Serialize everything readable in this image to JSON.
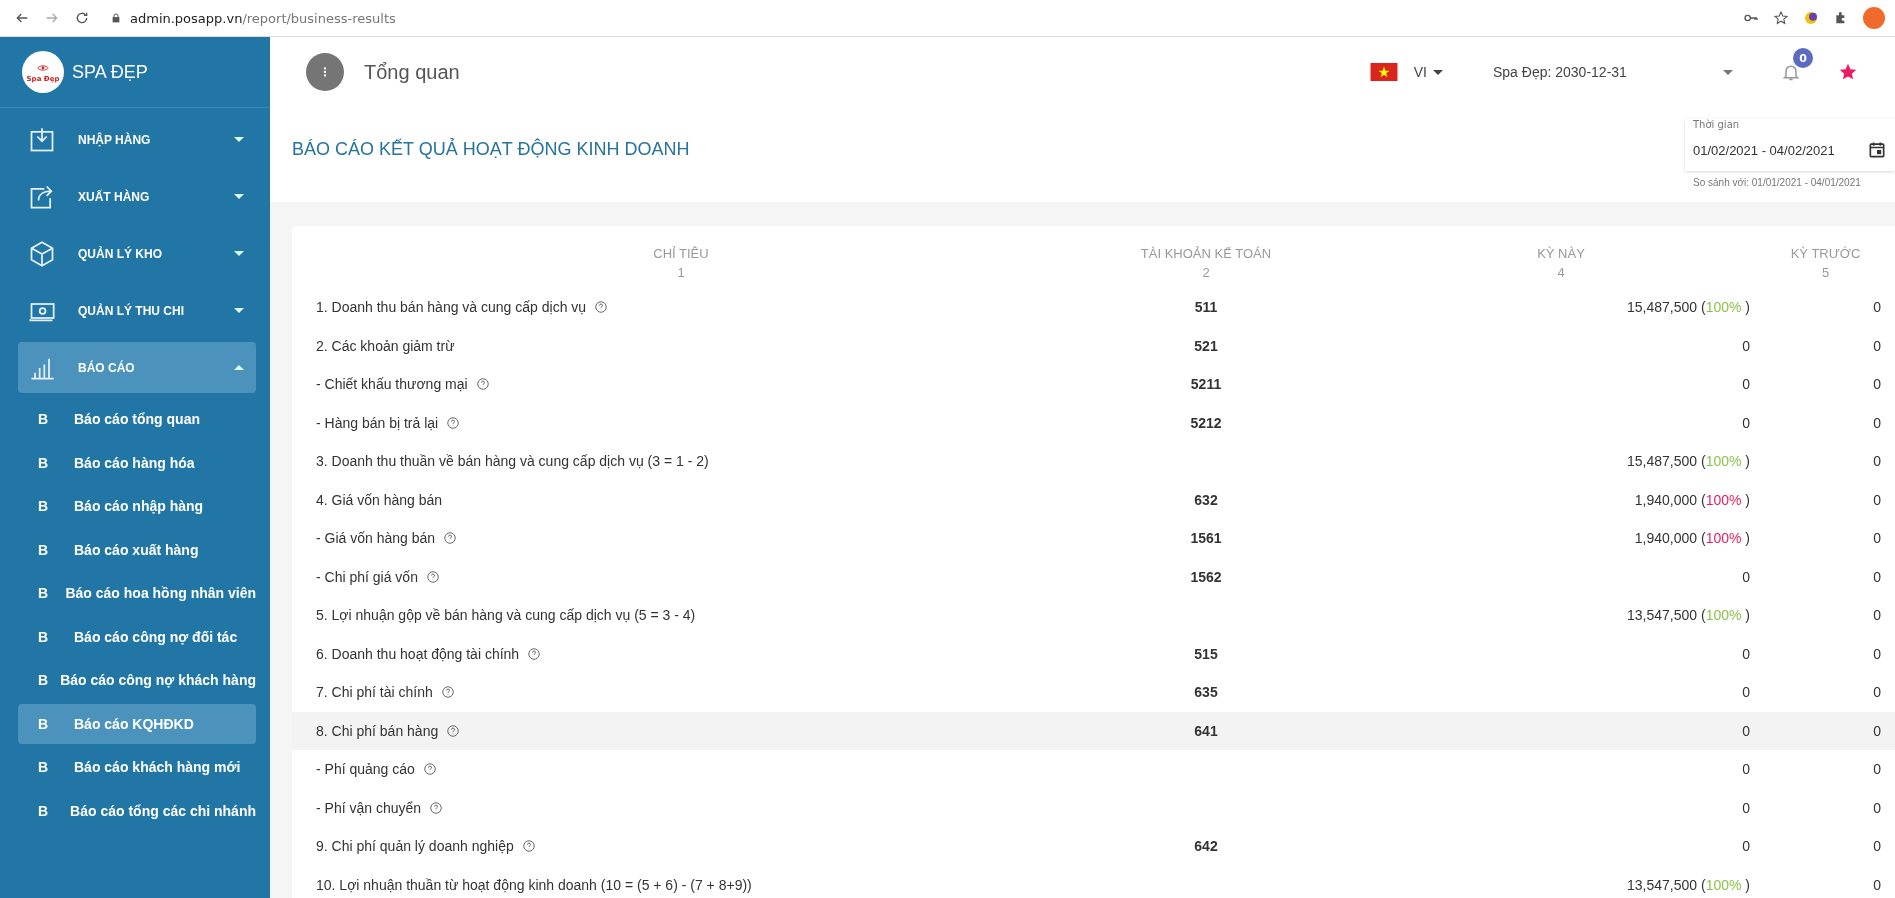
{
  "browser": {
    "url_host": "admin.posapp.vn",
    "url_path": "/report/business-results"
  },
  "sidebar": {
    "brand": "SPA ĐẸP",
    "logo_text": "Spa Đẹp",
    "items": [
      {
        "kind": "import",
        "label": "NHẬP HÀNG",
        "expanded": false,
        "selected": false
      },
      {
        "kind": "export",
        "label": "XUẤT HÀNG",
        "expanded": false,
        "selected": false
      },
      {
        "kind": "box",
        "label": "QUẢN LÝ KHO",
        "expanded": false,
        "selected": false
      },
      {
        "kind": "cash",
        "label": "QUẢN LÝ THU CHI",
        "expanded": false,
        "selected": false
      },
      {
        "kind": "chart",
        "label": "BÁO CÁO",
        "expanded": true,
        "selected": true,
        "children": [
          {
            "letter": "B",
            "label": "Báo cáo tổng quan",
            "selected": false
          },
          {
            "letter": "B",
            "label": "Báo cáo hàng hóa",
            "selected": false
          },
          {
            "letter": "B",
            "label": "Báo cáo nhập hàng",
            "selected": false
          },
          {
            "letter": "B",
            "label": "Báo cáo xuất hàng",
            "selected": false
          },
          {
            "letter": "B",
            "label": "Báo cáo hoa hồng nhân viên",
            "selected": false
          },
          {
            "letter": "B",
            "label": "Báo cáo công nợ đối tác",
            "selected": false
          },
          {
            "letter": "B",
            "label": "Báo cáo công nợ khách hàng",
            "selected": false
          },
          {
            "letter": "B",
            "label": "Báo cáo KQHĐKD",
            "selected": true
          },
          {
            "letter": "B",
            "label": "Báo cáo khách hàng mới",
            "selected": false
          },
          {
            "letter": "B",
            "label": "Báo cáo tổng các chi nhánh",
            "selected": false
          }
        ]
      }
    ]
  },
  "header": {
    "title": "Tổng quan",
    "language": "VI",
    "store": "Spa Đẹp: 2030-12-31",
    "notification_count": "0"
  },
  "report": {
    "title": "BÁO CÁO KẾT QUẢ HOẠT ĐỘNG KINH DOANH",
    "date_label": "Thời gian",
    "date_value": "01/02/2021 - 04/02/2021",
    "compare": "So sánh với: 01/01/2021 - 04/01/2021"
  },
  "table": {
    "columns": [
      {
        "name": "CHỈ TIÊU",
        "number": "1"
      },
      {
        "name": "TÀI KHOẢN KẾ TOÁN",
        "number": "2"
      },
      {
        "name": "KỲ NÀY",
        "number": "4"
      },
      {
        "name": "KỲ TRƯỚC",
        "number": "5"
      }
    ],
    "rows": [
      {
        "label": "1. Doanh thu bán hàng và cung cấp dịch vụ",
        "help": true,
        "account": "511",
        "current": "15,487,500",
        "open": "(",
        "percent": "100%",
        "close": ")",
        "color": "#8bc34a",
        "previous": "0",
        "highlighted": false
      },
      {
        "label": "2. Các khoản giảm trừ",
        "help": false,
        "account": "521",
        "current": "0",
        "previous": "0",
        "highlighted": false
      },
      {
        "label": "- Chiết khấu thương mại",
        "help": true,
        "account": "5211",
        "current": "0",
        "previous": "0",
        "highlighted": false
      },
      {
        "label": "- Hàng bán bị trả lại",
        "help": true,
        "account": "5212",
        "current": "0",
        "previous": "0",
        "highlighted": false
      },
      {
        "label": "3. Doanh thu thuần về bán hàng và cung cấp dịch vụ (3 = 1 - 2)",
        "help": false,
        "current": "15,487,500",
        "open": "(",
        "percent": "100%",
        "close": ")",
        "color": "#8bc34a",
        "previous": "0",
        "highlighted": false
      },
      {
        "label": "4. Giá vốn hàng bán",
        "help": false,
        "account": "632",
        "current": "1,940,000",
        "open": "(",
        "percent": "100%",
        "close": ")",
        "color": "#e91e63",
        "previous": "0",
        "highlighted": false
      },
      {
        "label": "- Giá vốn hàng bán",
        "help": true,
        "account": "1561",
        "current": "1,940,000",
        "open": "(",
        "percent": "100%",
        "close": ")",
        "color": "#e91e63",
        "previous": "0",
        "highlighted": false
      },
      {
        "label": "- Chi phí giá vốn",
        "help": true,
        "account": "1562",
        "current": "0",
        "previous": "0",
        "highlighted": false
      },
      {
        "label": "5. Lợi nhuận gộp về bán hàng và cung cấp dịch vụ (5 = 3 - 4)",
        "help": false,
        "current": "13,547,500",
        "open": "(",
        "percent": "100%",
        "close": ")",
        "color": "#8bc34a",
        "previous": "0",
        "highlighted": false
      },
      {
        "label": "6. Doanh thu hoạt động tài chính",
        "help": true,
        "account": "515",
        "current": "0",
        "previous": "0",
        "highlighted": false
      },
      {
        "label": "7. Chi phí tài chính",
        "help": true,
        "account": "635",
        "current": "0",
        "previous": "0",
        "highlighted": false
      },
      {
        "label": "8. Chi phí bán hàng",
        "help": true,
        "account": "641",
        "current": "0",
        "previous": "0",
        "highlighted": true
      },
      {
        "label": "- Phí quảng cáo",
        "help": true,
        "current": "0",
        "previous": "0",
        "highlighted": false
      },
      {
        "label": "- Phí vận chuyển",
        "help": true,
        "current": "0",
        "previous": "0",
        "highlighted": false
      },
      {
        "label": "9. Chi phí quản lý doanh nghiệp",
        "help": true,
        "account": "642",
        "current": "0",
        "previous": "0",
        "highlighted": false
      },
      {
        "label": "10. Lợi nhuận thuần từ hoạt động kinh doanh (10 = (5 + 6) - (7 + 8+9))",
        "help": false,
        "current": "13,547,500",
        "open": "(",
        "percent": "100%",
        "close": ")",
        "color": "#8bc34a",
        "previous": "0",
        "highlighted": false
      }
    ]
  }
}
